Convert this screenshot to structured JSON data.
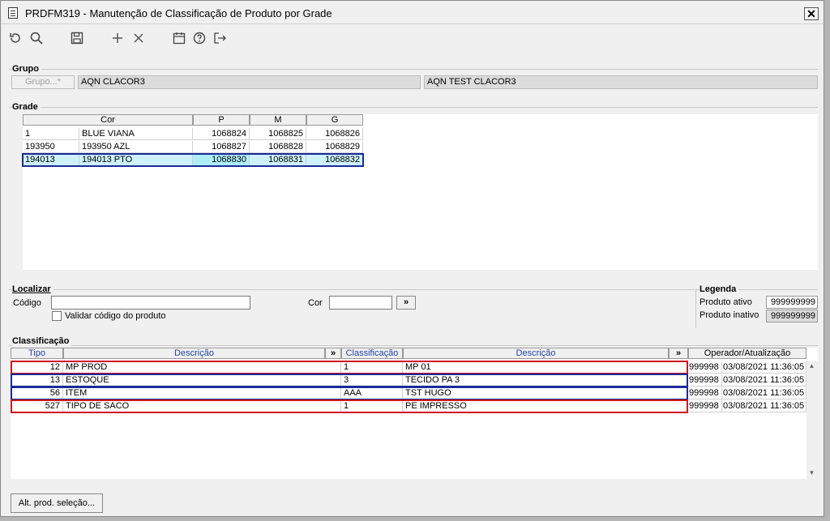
{
  "window": {
    "title": "PRDFM319 - Manutenção de Classificação de Produto por Grade",
    "close_label": "✕"
  },
  "toolbar": {
    "icons": [
      "refresh-icon",
      "search-icon",
      "save-icon",
      "add-icon",
      "delete-icon",
      "calendar-icon",
      "help-icon",
      "exit-icon"
    ]
  },
  "grupo": {
    "label": "Grupo",
    "button_label": "Grupo...*",
    "code": "AQN CLACOR3",
    "name": "AQN TEST CLACOR3"
  },
  "grade": {
    "label": "Grade",
    "columns": [
      "Cor",
      "P",
      "M",
      "G"
    ],
    "rows": [
      {
        "code": "1",
        "name": "BLUE VIANA",
        "p": "1068824",
        "m": "1068825",
        "g": "1068826"
      },
      {
        "code": "193950",
        "name": "193950 AZL",
        "p": "1068827",
        "m": "1068828",
        "g": "1068829"
      },
      {
        "code": "194013",
        "name": "194013 PTO",
        "p": "1068830",
        "m": "1068831",
        "g": "1068832"
      }
    ]
  },
  "localizar": {
    "label": "Localizar",
    "codigo_label": "Código",
    "codigo_value": "",
    "cor_label": "Cor",
    "cor_value": "",
    "go_label": "»",
    "validar_label": "Validar código do produto"
  },
  "legenda": {
    "label": "Legenda",
    "ativo_label": "Produto ativo",
    "ativo_value": "999999999",
    "inativo_label": "Produto inativo",
    "inativo_value": "999999999"
  },
  "classificacao": {
    "label": "Classificação",
    "columns": [
      "Tipo",
      "Descrição",
      "»",
      "Classificação",
      "Descrição",
      "»",
      "Operador/Atualização"
    ],
    "rows": [
      {
        "tipo": "12",
        "desc": "MP PROD",
        "clas": "1",
        "desc2": "MP 01",
        "op": "999998",
        "date": "03/08/2021 11:36:05"
      },
      {
        "tipo": "13",
        "desc": "ESTOQUE",
        "clas": "3",
        "desc2": "TECIDO PA 3",
        "op": "999998",
        "date": "03/08/2021 11:36:05"
      },
      {
        "tipo": "56",
        "desc": "ITEM",
        "clas": "AAA",
        "desc2": "TST HUGO",
        "op": "999998",
        "date": "03/08/2021 11:36:05"
      },
      {
        "tipo": "527",
        "desc": "TIPO DE SACO",
        "clas": "1",
        "desc2": "PE IMPRESSO",
        "op": "999998",
        "date": "03/08/2021 11:36:05"
      }
    ]
  },
  "footer": {
    "alt_button_label": "Alt. prod. seleção..."
  }
}
